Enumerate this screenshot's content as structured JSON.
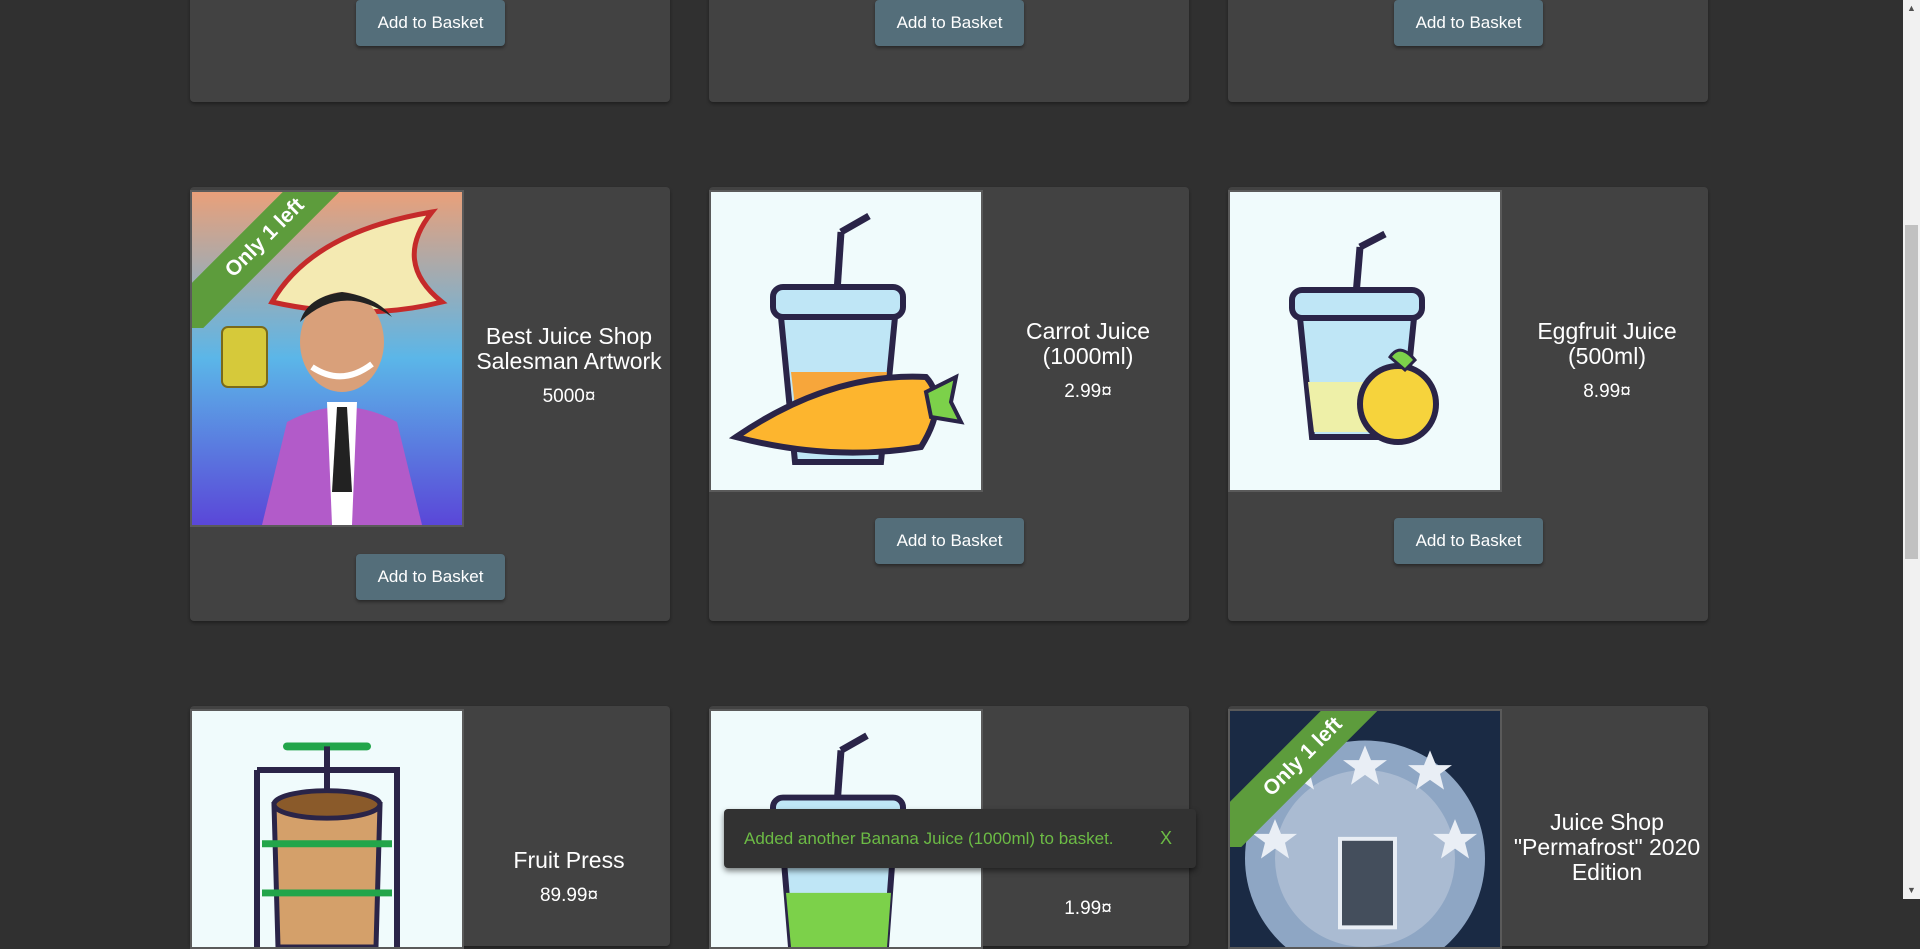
{
  "top_row": {
    "add_label": "Add to Basket"
  },
  "products": [
    {
      "name": "Best Juice Shop Salesman Artwork",
      "price": "5000¤",
      "badge": "Only 1 left",
      "add_label": "Add to Basket",
      "image": "salesman-artwork-image"
    },
    {
      "name": "Carrot Juice (1000ml)",
      "price": "2.99¤",
      "add_label": "Add to Basket",
      "image": "carrot-juice-image"
    },
    {
      "name": "Eggfruit Juice (500ml)",
      "price": "8.99¤",
      "add_label": "Add to Basket",
      "image": "eggfruit-juice-image"
    },
    {
      "name": "Fruit Press",
      "price": "89.99¤",
      "image": "fruit-press-image"
    },
    {
      "name": "",
      "price": "1.99¤",
      "image": "green-juice-image"
    },
    {
      "name": "Juice Shop \"Permafrost\" 2020 Edition",
      "price": "",
      "badge": "Only 1 left",
      "image": "permafrost-image"
    }
  ],
  "snackbar": {
    "message": "Added another Banana Juice (1000ml) to basket.",
    "close_label": "X"
  },
  "colors": {
    "background": "#303030",
    "card": "#424242",
    "button": "#546e7a",
    "ribbon": "#5d9c3c",
    "snack_text": "#6cbb45"
  }
}
